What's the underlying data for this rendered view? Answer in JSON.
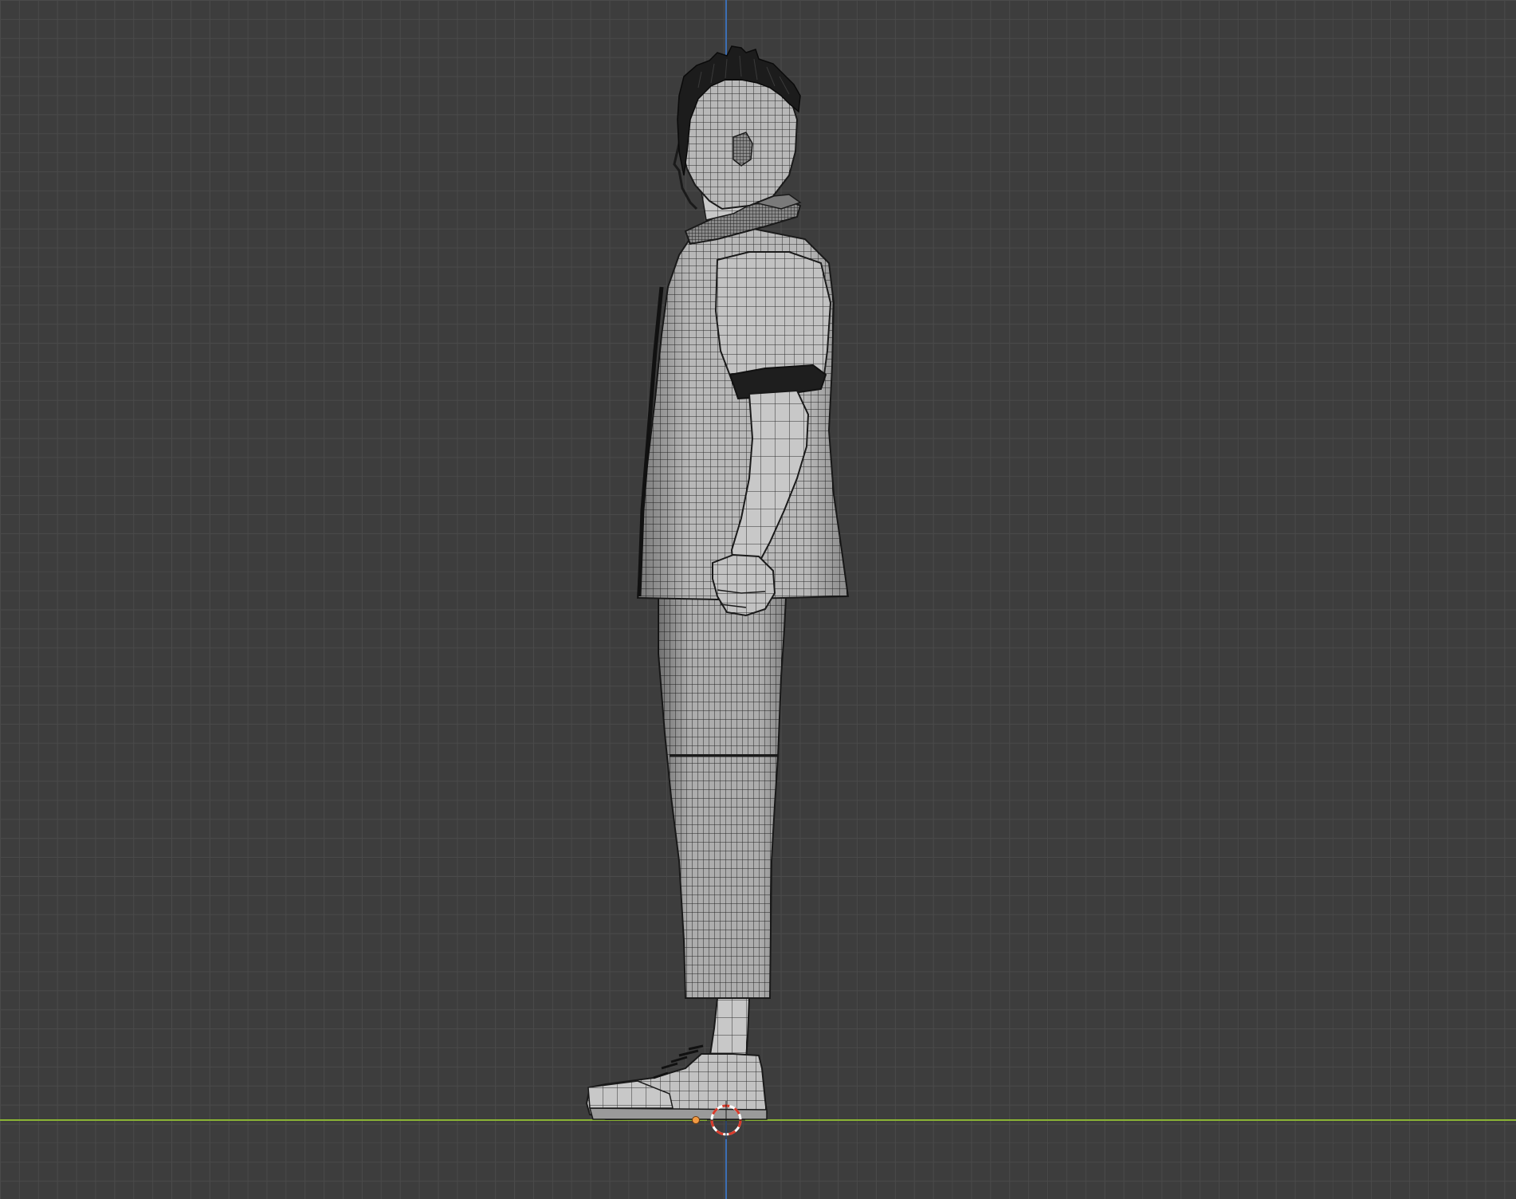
{
  "app": {
    "view": "Right Orthographic",
    "shading": "Solid + Wireframe overlay"
  },
  "colors": {
    "background": "#3d3d3d",
    "grid_line": "#4a4a4a",
    "grid_major": "#353535",
    "axis_y": "#8ab434",
    "axis_z": "#3d6fb5",
    "mesh_fill": "#b4b4b4",
    "wire": "#1a1a1a",
    "hair": "#1c1c1c",
    "cursor_red": "#d83a2a",
    "origin": "#f29a43"
  },
  "icons": {
    "cursor": "3d-cursor-icon",
    "origin": "object-origin-icon"
  }
}
